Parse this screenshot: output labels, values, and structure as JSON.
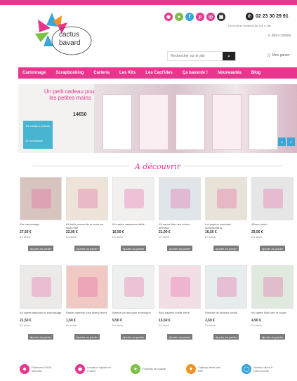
{
  "brand": {
    "name_line1": "cactus",
    "name_line2": "bavard",
    "colors": {
      "pink": "#e8368f",
      "blue": "#3aa6d8",
      "green": "#7cc142",
      "orange": "#f29222"
    }
  },
  "header": {
    "social": [
      {
        "icon": "rss-icon",
        "glyph": "◉",
        "color": "#e8368f"
      },
      {
        "icon": "location-icon",
        "glyph": "●",
        "color": "#7cc142"
      },
      {
        "icon": "facebook-icon",
        "glyph": "f",
        "color": "#3aa6d8"
      },
      {
        "icon": "pinterest-icon",
        "glyph": "p",
        "color": "#e8368f"
      },
      {
        "icon": "instagram-icon",
        "glyph": "◎",
        "color": "#e8368f"
      },
      {
        "icon": "blog-icon",
        "glyph": "▣",
        "color": "#333333"
      }
    ],
    "phone": "02 23 30 29 91",
    "phone_note": "Du lundi au vendredi de 10h à 18h",
    "account_link": "Mon compte",
    "search_placeholder": "Rechercher sur le site",
    "search_glyph": "⌕",
    "cart_label": "Mon panier"
  },
  "nav": [
    "Cartonnage",
    "Scrapbooking",
    "Carterie",
    "Les Kits",
    "Les Cact'ides",
    "Ça bavarde !",
    "Nouveautés",
    "Blog"
  ],
  "banner": {
    "headline": "Un petit cadeau pour les petites mains",
    "price": "14€50",
    "badge_text": "Kit création enfants",
    "badge_link": "Je commande",
    "prev_glyph": "‹",
    "next_glyph": "›"
  },
  "section_title": "A découvrir",
  "products": [
    {
      "name": "Kits cartonnage",
      "price": "27,50 €",
      "stock": "En stock",
      "cta": "Ajouter au panier"
    },
    {
      "name": "Kit boîte couvercle et socle en tissu rose",
      "price": "22,90 €",
      "stock": "En stock",
      "cta": "Ajouter au panier"
    },
    {
      "name": "Kit cartes naissance bébé",
      "price": "16,50 €",
      "stock": "En stock",
      "cta": "Ajouter au panier"
    },
    {
      "name": "Kit cartes fête des mères animaux",
      "price": "21,90 €",
      "stock": "En stock",
      "cta": "Ajouter au panier"
    },
    {
      "name": "Lot papiers imprimés scrapbooking",
      "price": "16,50 €",
      "stock": "En stock",
      "cta": "Ajouter au panier"
    },
    {
      "name": "Album photo",
      "price": "29,50 €",
      "stock": "En stock",
      "cta": "Ajouter au panier"
    },
    {
      "name": "Kit cartes tampons et embossage",
      "price": "21,50 €",
      "stock": "En stock",
      "cta": "Ajouter au panier"
    },
    {
      "name": "Papier imprimé rose liberty fleurs",
      "price": "1,50 €",
      "stock": "En stock",
      "cta": "Ajouter au panier"
    },
    {
      "name": "Matrice de découpe enveloppe",
      "price": "9,50 €",
      "stock": "En stock",
      "cta": "Ajouter au panier"
    },
    {
      "name": "Bloc papiers motifs bébé",
      "price": "15,50 €",
      "stock": "En stock",
      "cta": "Ajouter au panier"
    },
    {
      "name": "Planche de stickers ronds",
      "price": "3,50 €",
      "stock": "En stock",
      "cta": "Ajouter au panier"
    },
    {
      "name": "Kit cartes Noël vert et rouge",
      "price": "4,90 €",
      "stock": "En stock",
      "cta": "Ajouter au panier"
    }
  ],
  "footer": [
    {
      "icon": "card-icon",
      "glyph": "◆",
      "color": "#e8368f",
      "text": "Paiement 100% sécurisé"
    },
    {
      "icon": "truck-icon",
      "glyph": "●",
      "color": "#e8368f",
      "text": "Livraison rapide en France"
    },
    {
      "icon": "star-icon",
      "glyph": "★",
      "color": "#7cc142",
      "text": "Produits de qualité"
    },
    {
      "icon": "gift-icon",
      "glyph": "♦",
      "color": "#f29222",
      "text": "Cadeau offert dès 50€"
    },
    {
      "icon": "chat-icon",
      "glyph": "◯",
      "color": "#3aa6d8",
      "text": "Service client à votre écoute"
    }
  ]
}
